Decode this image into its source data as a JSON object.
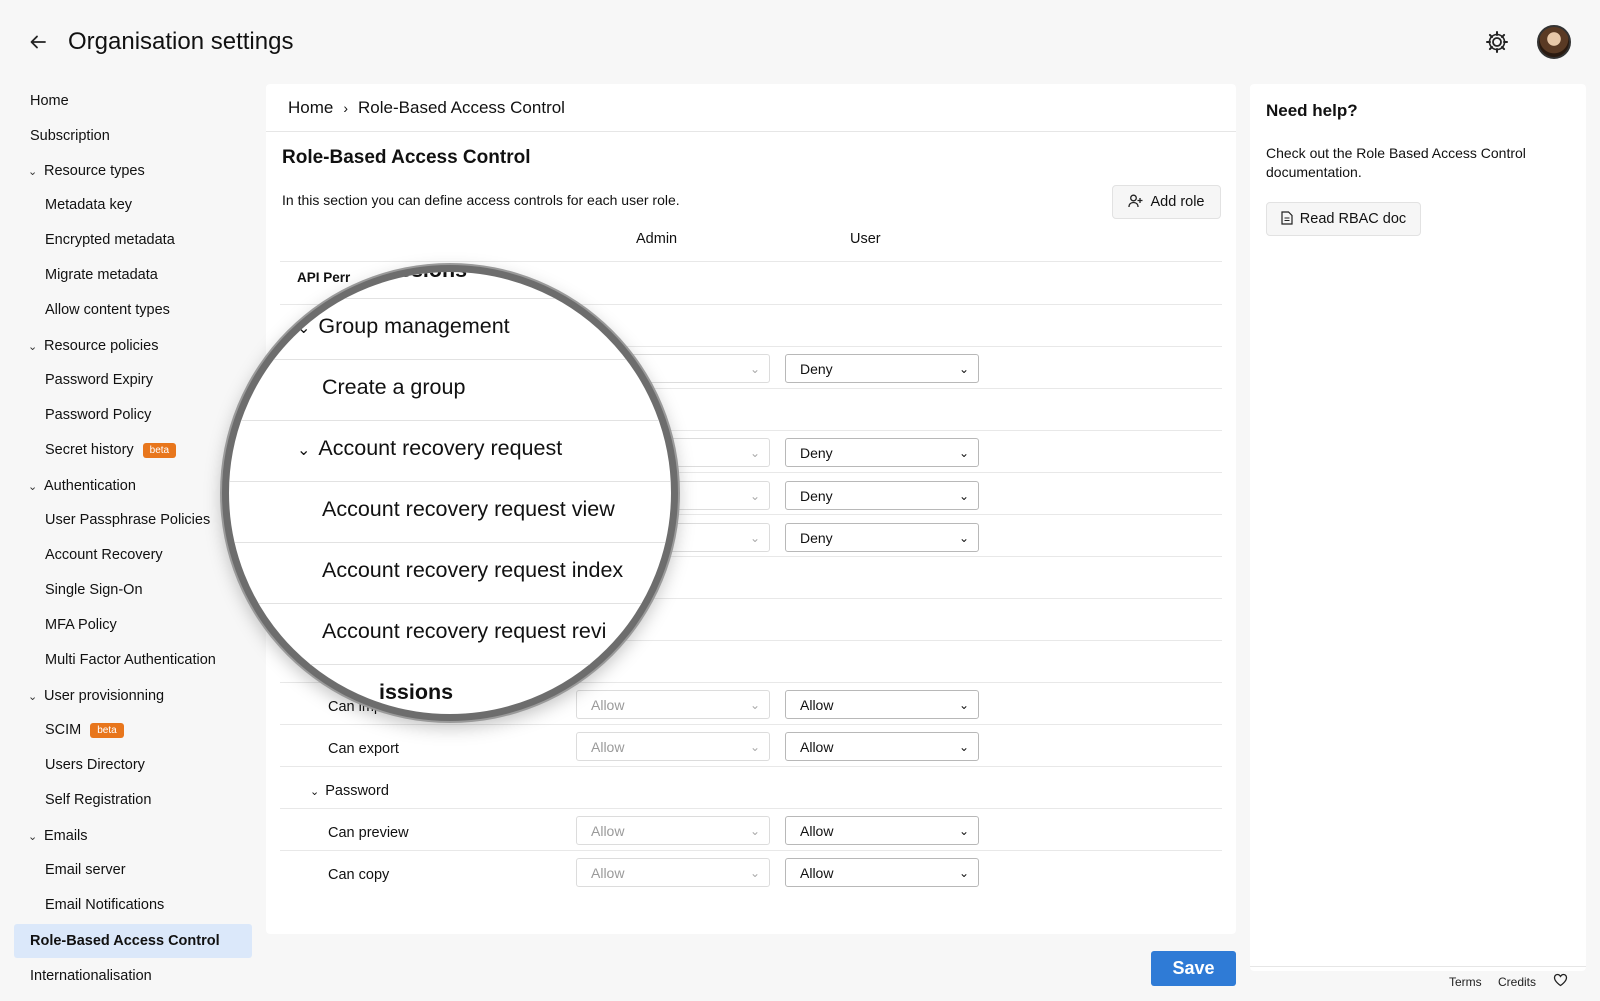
{
  "header": {
    "back_icon": "arrow-left-icon",
    "title": "Organisation settings",
    "settings_icon": "gear-icon"
  },
  "sidebar": {
    "items": [
      {
        "label": "Home"
      },
      {
        "label": "Subscription"
      },
      {
        "label": "Resource types"
      },
      {
        "label": "Metadata key"
      },
      {
        "label": "Encrypted metadata"
      },
      {
        "label": "Migrate metadata"
      },
      {
        "label": "Allow content types"
      },
      {
        "label": "Resource policies"
      },
      {
        "label": "Password Expiry"
      },
      {
        "label": "Password Policy"
      },
      {
        "label": "Secret history",
        "badge": "beta"
      },
      {
        "label": "Authentication"
      },
      {
        "label": "User Passphrase Policies"
      },
      {
        "label": "Account Recovery"
      },
      {
        "label": "Single Sign-On"
      },
      {
        "label": "MFA Policy"
      },
      {
        "label": "Multi Factor Authentication"
      },
      {
        "label": "User provisionning"
      },
      {
        "label": "SCIM",
        "badge": "beta"
      },
      {
        "label": "Users Directory"
      },
      {
        "label": "Self Registration"
      },
      {
        "label": "Emails"
      },
      {
        "label": "Email server"
      },
      {
        "label": "Email Notifications"
      },
      {
        "label": "Role-Based Access Control"
      },
      {
        "label": "Internationalisation"
      }
    ]
  },
  "main": {
    "breadcrumb": {
      "home": "Home",
      "separator": "›",
      "current": "Role-Based Access Control"
    },
    "title": "Role-Based Access Control",
    "description": "In this section you can define access controls for each user role.",
    "add_role_label": "Add role",
    "columns": {
      "admin": "Admin",
      "user": "User"
    },
    "api_permissions_partial": "API Perr",
    "rows": [
      {
        "user": "Deny"
      },
      {
        "user": "Deny"
      },
      {
        "user": "Deny"
      },
      {
        "user": "Deny"
      }
    ],
    "lower_rows": {
      "can_import": {
        "label": "Can import",
        "admin": "Allow",
        "user": "Allow"
      },
      "can_export": {
        "label": "Can export",
        "admin": "Allow",
        "user": "Allow"
      },
      "password_group": "Password",
      "can_preview": {
        "label": "Can preview",
        "admin": "Allow",
        "user": "Allow"
      },
      "can_copy": {
        "label": "Can copy",
        "admin": "Allow",
        "user": "Allow"
      }
    },
    "save_label": "Save"
  },
  "magnifier": {
    "top_partial": "ssions",
    "group_management": "Group management",
    "create_group": "Create a group",
    "account_recovery_request": "Account recovery request",
    "arr_view": "Account recovery request view",
    "arr_index": "Account recovery request index",
    "arr_review": "Account recovery request revi",
    "bottom_partial": "issions"
  },
  "help": {
    "title": "Need help?",
    "text": "Check out the Role Based Access Control documentation.",
    "button_label": "Read RBAC doc"
  },
  "footer": {
    "terms": "Terms",
    "credits": "Credits"
  },
  "colors": {
    "primary": "#2f7bd6",
    "active_nav": "#dbe8fa",
    "beta_badge": "#e8761c"
  }
}
